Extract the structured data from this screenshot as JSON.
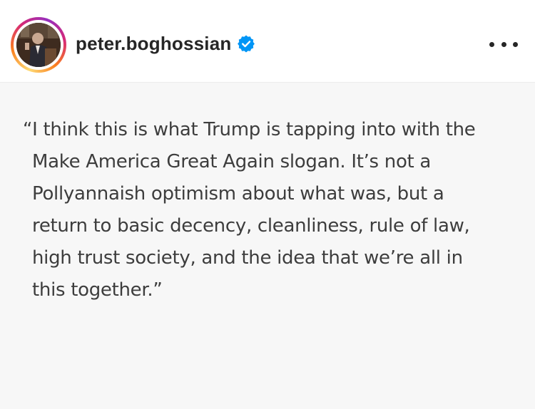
{
  "header": {
    "username": "peter.boghossian",
    "verified_icon": "verified-badge-icon",
    "more_icon": "more-options-icon"
  },
  "post": {
    "quote_lines": [
      "“I think this is what Trump is tapping into with the",
      "Make America Great Again slogan. It’s not a",
      "Pollyannaish optimism about what was, but a",
      "return to basic decency, cleanliness, rule of law,",
      "high trust society, and the idea that we’re all in",
      "this together.”"
    ]
  },
  "colors": {
    "verified_blue": "#0095f6",
    "post_background": "#f7f7f7",
    "text": "#3d3d3d"
  }
}
